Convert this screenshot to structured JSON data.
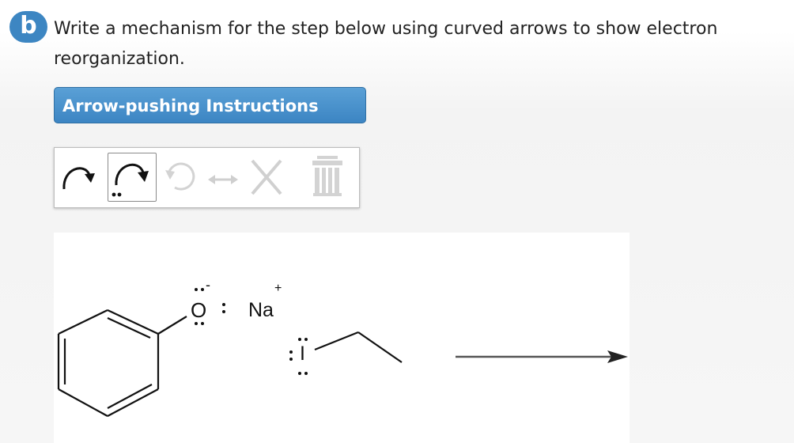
{
  "question": {
    "part_label": "b",
    "text": "Write a mechanism for the step below using curved arrows to show electron reorganization."
  },
  "instructions_button": {
    "label": "Arrow-pushing Instructions"
  },
  "toolbar": {
    "tools": [
      {
        "icon": "single-curved-arrow-icon",
        "enabled": true,
        "selected": false
      },
      {
        "icon": "lone-pair-curved-arrow-icon",
        "enabled": true,
        "selected": true
      },
      {
        "icon": "rotate-icon",
        "enabled": false
      },
      {
        "icon": "resonance-arrow-icon",
        "enabled": false
      },
      {
        "icon": "close-icon",
        "enabled": false
      },
      {
        "icon": "trash-icon",
        "enabled": false
      }
    ]
  },
  "reaction": {
    "oxygen_label": "O",
    "oxygen_charge": "-",
    "sodium_label": "Na",
    "sodium_charge": "+",
    "iodine_label": "I"
  },
  "colors": {
    "badge": "#3d86c2",
    "button": "#4a92cd",
    "disabled_icon": "#d0d0d0"
  }
}
